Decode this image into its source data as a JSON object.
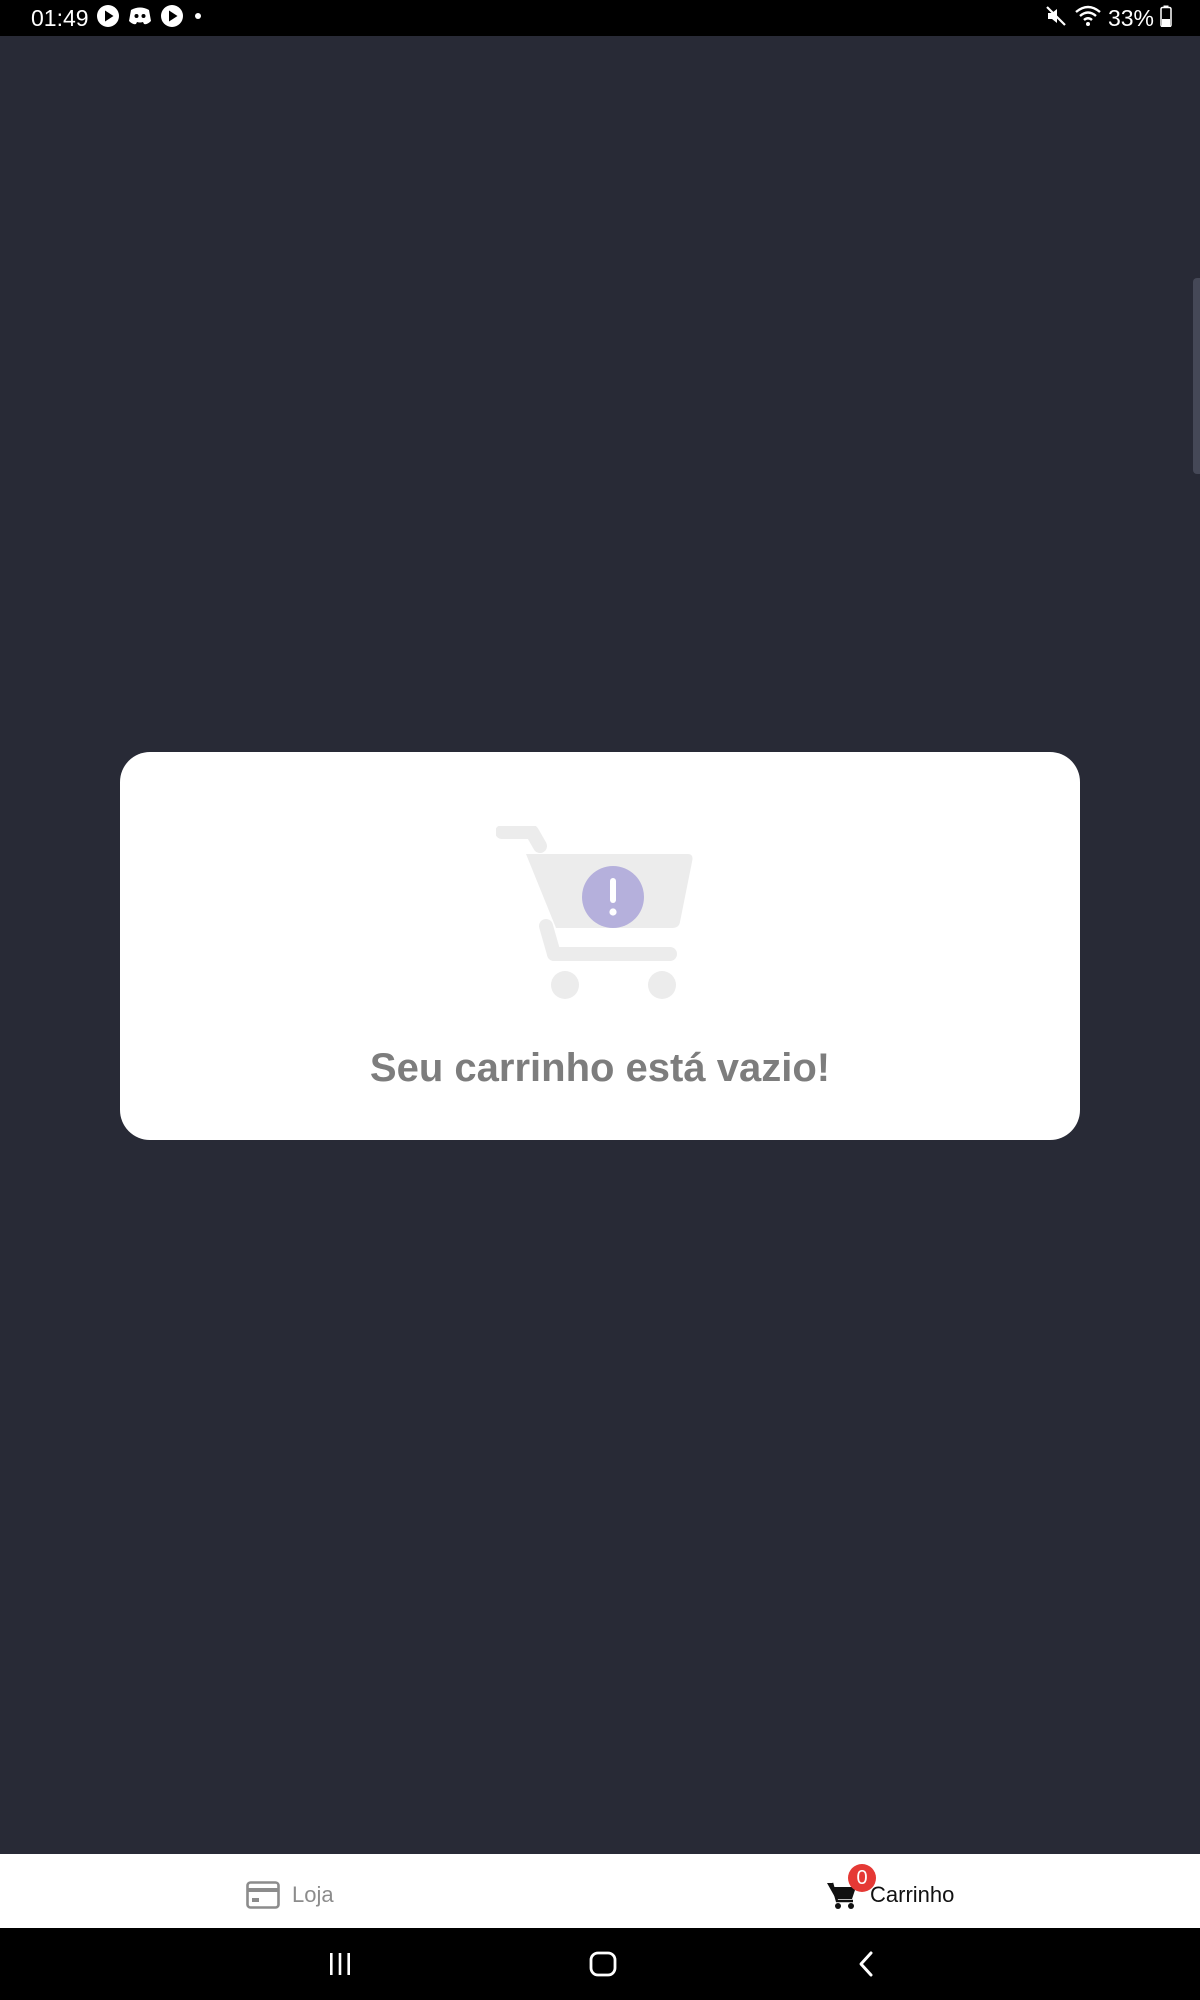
{
  "status_bar": {
    "time": "01:49",
    "battery": "33%",
    "left_icons": [
      "play-icon",
      "discord-icon",
      "play-icon",
      "dot-icon"
    ],
    "right_icons": [
      "mute-icon",
      "wifi-icon",
      "battery-icon"
    ]
  },
  "empty_cart": {
    "illustration": "cart-alert-icon",
    "message": "Seu carrinho está vazio!",
    "accent_color": "#b5b0dc",
    "cart_color": "#ececec"
  },
  "tab_bar": {
    "tabs": [
      {
        "label": "Loja",
        "icon": "card-icon",
        "active": false
      },
      {
        "label": "Carrinho",
        "icon": "cart-icon",
        "active": true,
        "badge": "0"
      }
    ],
    "badge_color": "#e53935"
  },
  "nav_bar": {
    "buttons": [
      "recents-icon",
      "home-icon",
      "back-icon"
    ]
  },
  "colors": {
    "background": "#282a36",
    "card": "#ffffff",
    "message_text": "#7d7d7d"
  }
}
